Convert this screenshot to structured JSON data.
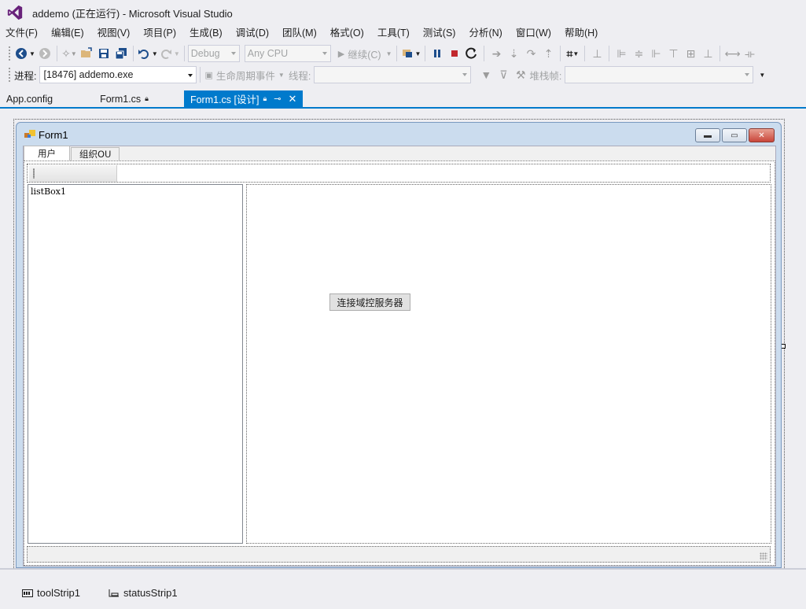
{
  "window": {
    "title": "addemo (正在运行) - Microsoft Visual Studio"
  },
  "menu": [
    "文件(F)",
    "编辑(E)",
    "视图(V)",
    "项目(P)",
    "生成(B)",
    "调试(D)",
    "团队(M)",
    "格式(O)",
    "工具(T)",
    "测试(S)",
    "分析(N)",
    "窗口(W)",
    "帮助(H)"
  ],
  "toolbar": {
    "config": "Debug",
    "platform": "Any CPU",
    "continue_label": "继续(C)"
  },
  "debug_bar": {
    "process_label": "进程:",
    "process_value": "[18476] addemo.exe",
    "lifecycle_label": "生命周期事件",
    "thread_label": "线程:",
    "stackframe_label": "堆栈帧:"
  },
  "doc_tabs": [
    {
      "label": "App.config",
      "active": false
    },
    {
      "label": "Form1.cs",
      "active": false
    },
    {
      "label": "Form1.cs [设计]",
      "active": true
    }
  ],
  "form": {
    "title": "Form1",
    "tabs": [
      "用户",
      "组织OU"
    ],
    "listbox_name": "listBox1",
    "connect_button": "连接域控服务器"
  },
  "tray": {
    "toolstrip": "toolStrip1",
    "statusstrip": "statusStrip1"
  },
  "colors": {
    "accent": "#007acc",
    "vs_purple": "#68217a",
    "stop_red": "#c1272d"
  }
}
